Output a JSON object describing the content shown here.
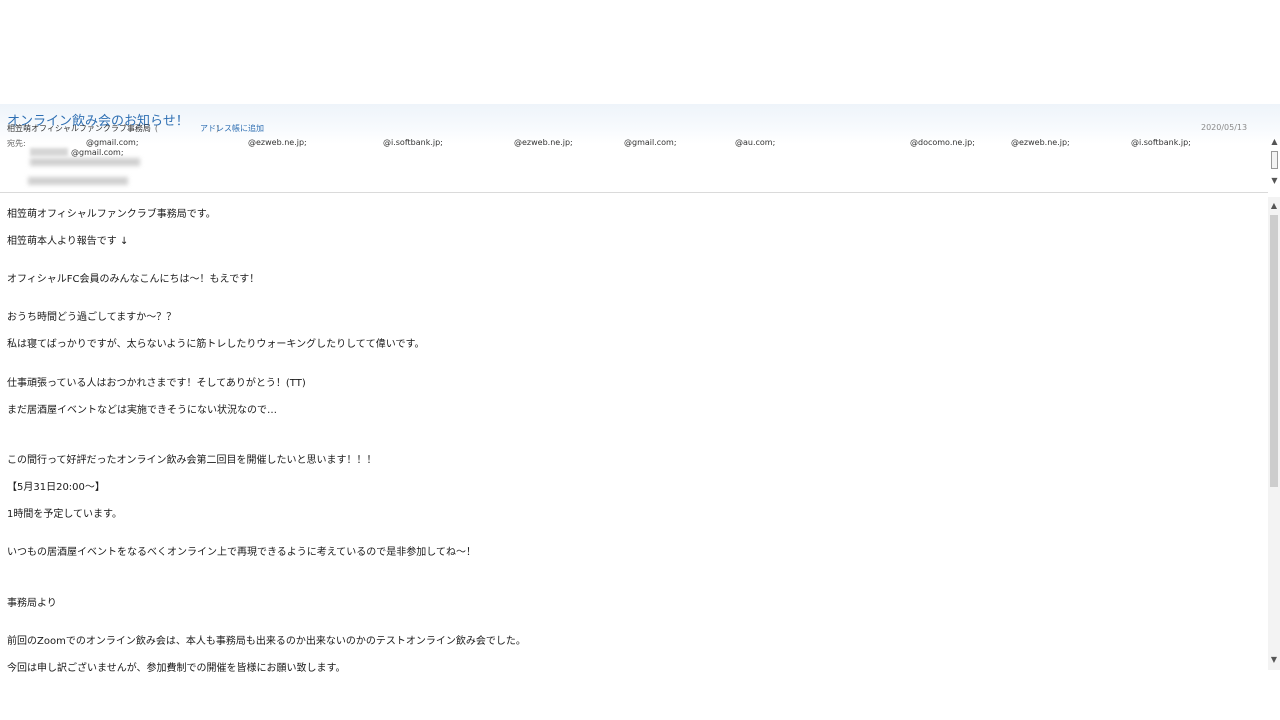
{
  "header": {
    "subject": "オンライン飲み会のお知らせ！",
    "sender_name": "相笠萌オフィシャルファンクラブ事務局",
    "sender_addr_open": "(",
    "sender_addr_close": ")",
    "add_contact_label": "アドレス帳に追加",
    "date": "2020/05/13",
    "to_label": "宛先:",
    "recipients": [
      "@gmail.com;",
      "@ezweb.ne.jp;",
      "@i.softbank.jp;",
      "@ezweb.ne.jp;",
      "@gmail.com;",
      "@au.com;",
      "@docomo.ne.jp;",
      "@ezweb.ne.jp;",
      "@i.softbank.jp;"
    ],
    "recipient_line2": "@gmail.com;"
  },
  "body": {
    "lines": [
      "相笠萌オフィシャルファンクラブ事務局です。",
      "相笠萌本人より報告です ↓",
      "オフィシャルFC会員のみんなこんにちは〜！もえです！",
      "おうち時間どう過ごしてますか〜？？",
      "私は寝てばっかりですが、太らないように筋トレしたりウォーキングしたりしてて偉いです。",
      "仕事頑張っている人はおつかれさまです！そしてありがとう！(TT)",
      "まだ居酒屋イベントなどは実施できそうにない状況なので…",
      "この間行って好評だったオンライン飲み会第二回目を開催したいと思います！！！",
      "【5月31日20:00〜】",
      "1時間を予定しています。",
      "いつもの居酒屋イベントをなるべくオンライン上で再現できるように考えているので是非参加してね〜！",
      "事務局より",
      "前回のZoomでのオンライン飲み会は、本人も事務局も出来るのか出来ないのかのテストオンライン飲み会でした。",
      "今回は申し訳ございませんが、参加費制での開催を皆様にお願い致します。"
    ]
  },
  "icons": {
    "scroll_up": "▲",
    "scroll_down": "▼"
  }
}
